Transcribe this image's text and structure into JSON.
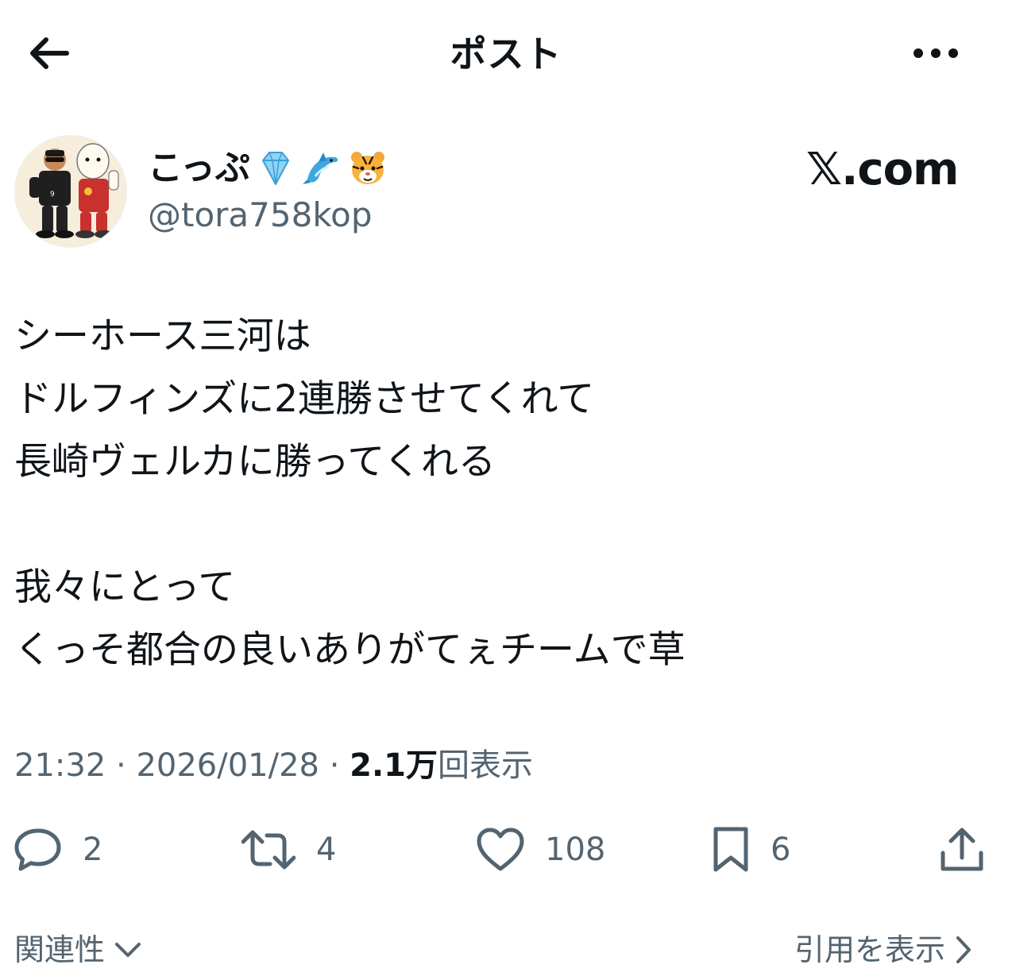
{
  "header": {
    "title": "ポスト",
    "back_icon": "arrow-left-icon",
    "more_icon": "more-horizontal-icon"
  },
  "author": {
    "name": "こっぷ",
    "name_emojis": [
      "gem-emoji",
      "dolphin-emoji",
      "tiger-face-emoji"
    ],
    "handle": "@tora758kop"
  },
  "watermark": "𝕏.com",
  "post": {
    "lines": [
      "シーホース三河は",
      "ドルフィンズに2連勝させてくれて",
      "長崎ヴェルカに勝ってくれる",
      "",
      "我々にとって",
      "くっそ都合の良いありがてぇチームで草"
    ]
  },
  "meta": {
    "time": "21:32",
    "separator": " · ",
    "date": "2026/01/28",
    "views_count": "2.1万",
    "views_label": "回表示"
  },
  "actions": {
    "replies": "2",
    "reposts": "4",
    "likes": "108",
    "bookmarks": "6"
  },
  "footer": {
    "related_label": "関連性",
    "quotes_label": "引用を表示"
  },
  "colors": {
    "text_primary": "#0f1419",
    "text_secondary": "#536471",
    "background": "#ffffff"
  }
}
